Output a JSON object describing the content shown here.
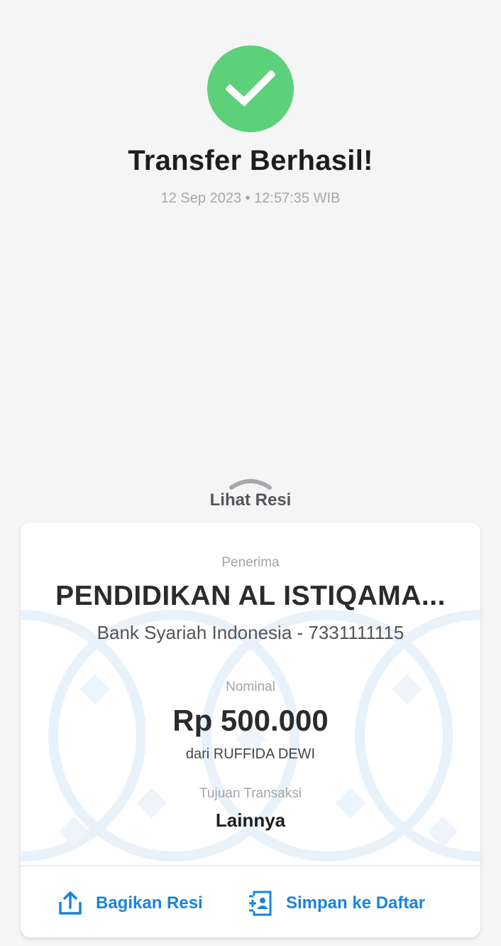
{
  "header": {
    "title": "Transfer Berhasil!",
    "timestamp": "12 Sep 2023 • 12:57:35 WIB",
    "status_icon": "check-circle-icon",
    "status_color": "#5dd07a"
  },
  "receipt_toggle": {
    "label": "Lihat Resi",
    "icon": "chevron-up-icon"
  },
  "receipt": {
    "recipient_label": "Penerima",
    "recipient_name": "PENDIDIKAN AL ISTIQAMA...",
    "recipient_bank": "Bank Syariah Indonesia - 7331111115",
    "amount_label": "Nominal",
    "amount": "Rp 500.000",
    "from": "dari RUFFIDA DEWI",
    "purpose_label": "Tujuan Transaksi",
    "purpose": "Lainnya"
  },
  "actions": {
    "share_label": "Bagikan Resi",
    "share_icon": "share-icon",
    "save_label": "Simpan ke Daftar",
    "save_icon": "contact-add-icon",
    "accent_color": "#1a84d8"
  }
}
